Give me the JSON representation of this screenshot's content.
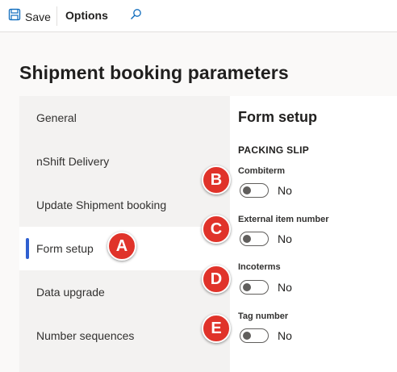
{
  "toolbar": {
    "save_label": "Save",
    "options_label": "Options"
  },
  "page": {
    "title": "Shipment booking parameters"
  },
  "nav": {
    "items": [
      {
        "label": "General"
      },
      {
        "label": "nShift Delivery"
      },
      {
        "label": "Update Shipment booking"
      },
      {
        "label": "Form setup"
      },
      {
        "label": "Data upgrade"
      },
      {
        "label": "Number sequences"
      }
    ],
    "active_index": 3
  },
  "panel": {
    "title": "Form setup",
    "section": "PACKING SLIP",
    "fields": [
      {
        "label": "Combiterm",
        "value": "No"
      },
      {
        "label": "External item number",
        "value": "No"
      },
      {
        "label": "Incoterms",
        "value": "No"
      },
      {
        "label": "Tag number",
        "value": "No"
      }
    ]
  },
  "callouts": [
    "A",
    "B",
    "C",
    "D",
    "E"
  ],
  "colors": {
    "accent": "#2f5fd0",
    "callout": "#e0332a",
    "save_icon": "#0f6cbd"
  },
  "icons": {
    "save": "save-icon",
    "search": "search-icon"
  }
}
